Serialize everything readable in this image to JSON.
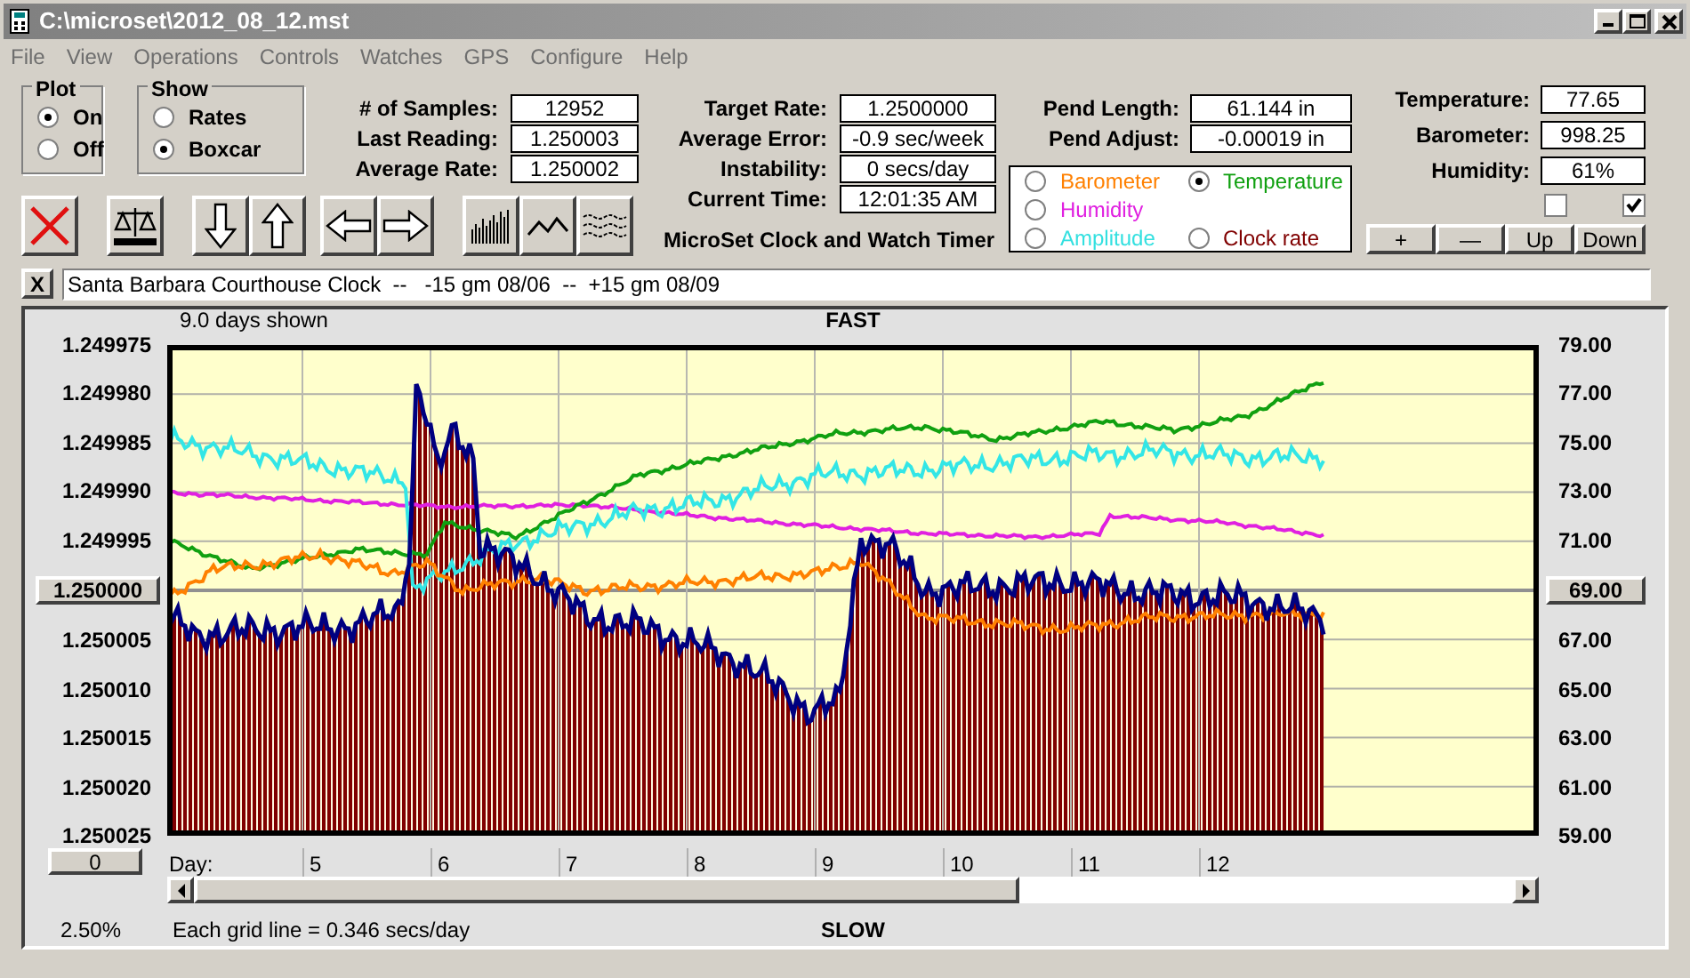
{
  "window": {
    "title": "C:\\microset\\2012_08_12.mst"
  },
  "menu": [
    "File",
    "View",
    "Operations",
    "Controls",
    "Watches",
    "GPS",
    "Configure",
    "Help"
  ],
  "plot_group": {
    "label": "Plot",
    "options": [
      {
        "label": "On",
        "selected": true
      },
      {
        "label": "Off",
        "selected": false
      }
    ]
  },
  "show_group": {
    "label": "Show",
    "options": [
      {
        "label": "Rates",
        "selected": false
      },
      {
        "label": "Boxcar",
        "selected": true
      }
    ]
  },
  "readout_columns": [
    {
      "fields": [
        {
          "label": "# of Samples:",
          "value": "12952"
        },
        {
          "label": "Last Reading:",
          "value": "1.250003"
        },
        {
          "label": "Average Rate:",
          "value": "1.250002"
        }
      ]
    },
    {
      "fields": [
        {
          "label": "Target Rate:",
          "value": "1.2500000"
        },
        {
          "label": "Average Error:",
          "value": "-0.9 sec/week"
        },
        {
          "label": "Instability:",
          "value": "0 secs/day"
        },
        {
          "label": "Current Time:",
          "value": "12:01:35 AM"
        }
      ]
    },
    {
      "fields": [
        {
          "label": "Pend Length:",
          "value": "61.144 in"
        },
        {
          "label": "Pend Adjust:",
          "value": "-0.00019 in"
        }
      ]
    },
    {
      "fields": [
        {
          "label": "Temperature:",
          "value": "77.65"
        },
        {
          "label": "Barometer:",
          "value": "998.25"
        },
        {
          "label": "Humidity:",
          "value": "61%"
        }
      ]
    }
  ],
  "toolbar": [
    {
      "kind": "delete"
    },
    {
      "kind": "balance"
    },
    {
      "kind": "down"
    },
    {
      "kind": "up"
    },
    {
      "kind": "left"
    },
    {
      "kind": "right"
    },
    {
      "kind": "bars"
    },
    {
      "kind": "line"
    },
    {
      "kind": "waves"
    }
  ],
  "app_title": "MicroSet Clock and Watch Timer",
  "legend": [
    {
      "label": "Barometer",
      "color": "#ff8000",
      "selected": false
    },
    {
      "label": "Temperature",
      "color": "#10a010",
      "selected": true
    },
    {
      "label": "Humidity",
      "color": "#e020e0",
      "selected": false
    },
    {
      "label": "Amplitude",
      "color": "#33e0e0",
      "selected": false
    },
    {
      "label": "Clock rate",
      "color": "#800000",
      "selected": false
    }
  ],
  "checkboxes": [
    {
      "checked": false
    },
    {
      "checked": true
    }
  ],
  "adjust_buttons": [
    "+",
    "—",
    "Up",
    "Down"
  ],
  "note": {
    "close": "X",
    "value": "Santa Barbara Courthouse Clock  --   -15 gm 08/06  --  +15 gm 08/09"
  },
  "chart": {
    "days_shown": "9.0 days shown",
    "top_label": "FAST",
    "bottom_label": "SLOW",
    "left_ticks": [
      {
        "text": "1.249975",
        "kind": "label"
      },
      {
        "text": "1.249980",
        "kind": "label"
      },
      {
        "text": "1.249985",
        "kind": "label"
      },
      {
        "text": "1.249990",
        "kind": "label"
      },
      {
        "text": "1.249995",
        "kind": "label"
      },
      {
        "text": "1.250000",
        "kind": "button"
      },
      {
        "text": "1.250005",
        "kind": "label"
      },
      {
        "text": "1.250010",
        "kind": "label"
      },
      {
        "text": "1.250015",
        "kind": "label"
      },
      {
        "text": "1.250020",
        "kind": "label"
      },
      {
        "text": "1.250025",
        "kind": "label"
      }
    ],
    "right_ticks": [
      {
        "text": "79.00",
        "kind": "label"
      },
      {
        "text": "77.00",
        "kind": "label"
      },
      {
        "text": "75.00",
        "kind": "label"
      },
      {
        "text": "73.00",
        "kind": "label"
      },
      {
        "text": "71.00",
        "kind": "label"
      },
      {
        "text": "69.00",
        "kind": "button"
      },
      {
        "text": "67.00",
        "kind": "label"
      },
      {
        "text": "65.00",
        "kind": "label"
      },
      {
        "text": "63.00",
        "kind": "label"
      },
      {
        "text": "61.00",
        "kind": "label"
      },
      {
        "text": "59.00",
        "kind": "label"
      }
    ],
    "offset_button": "0",
    "day_label": "Day:",
    "days": [
      "5",
      "6",
      "7",
      "8",
      "9",
      "10",
      "11",
      "12"
    ],
    "percent": "2.50%",
    "grid_note": "Each grid line = 0.346 secs/day"
  }
}
